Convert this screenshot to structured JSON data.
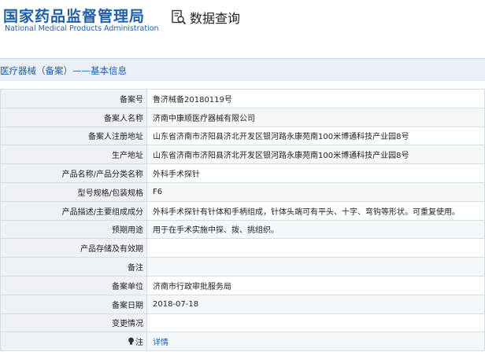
{
  "header": {
    "logo_cn": "国家药品监督管理局",
    "logo_en": "National Medical Products Administration",
    "query_label": "数据查询"
  },
  "section": {
    "title": "医疗器械（备案）——基本信息"
  },
  "rows": [
    {
      "label": "备案号",
      "value": "鲁济械备20180119号"
    },
    {
      "label": "备案人名称",
      "value": "济南中康顺医疗器械有限公司"
    },
    {
      "label": "备案人注册地址",
      "value": "山东省济南市济阳县济北开发区银河路永康苑南100米博通科技产业园8号"
    },
    {
      "label": "生产地址",
      "value": "山东省济南市济阳县济北开发区银河路永康苑南100米博通科技产业园8号"
    },
    {
      "label": "产品名称/产品分类名称",
      "value": "外科手术探针"
    },
    {
      "label": "型号规格/包装规格",
      "value": "F6"
    },
    {
      "label": "产品描述/主要组成成分",
      "value": "外科手术探针有针体和手柄组成，针体头端可有平头、十字、弯钩等形状。可重复使用。"
    },
    {
      "label": "预期用途",
      "value": "用于在手术实施中探、拨、挑组织。"
    },
    {
      "label": "产品存储及有效期",
      "value": ""
    },
    {
      "label": "备注",
      "value": ""
    },
    {
      "label": "备案单位",
      "value": "济南市行政审批服务局"
    },
    {
      "label": "备案日期",
      "value": "2018-07-18"
    },
    {
      "label": "变更情况",
      "value": ""
    }
  ],
  "note_row": {
    "label": "注",
    "link": "详情",
    "icon": "lightbulb-icon"
  }
}
